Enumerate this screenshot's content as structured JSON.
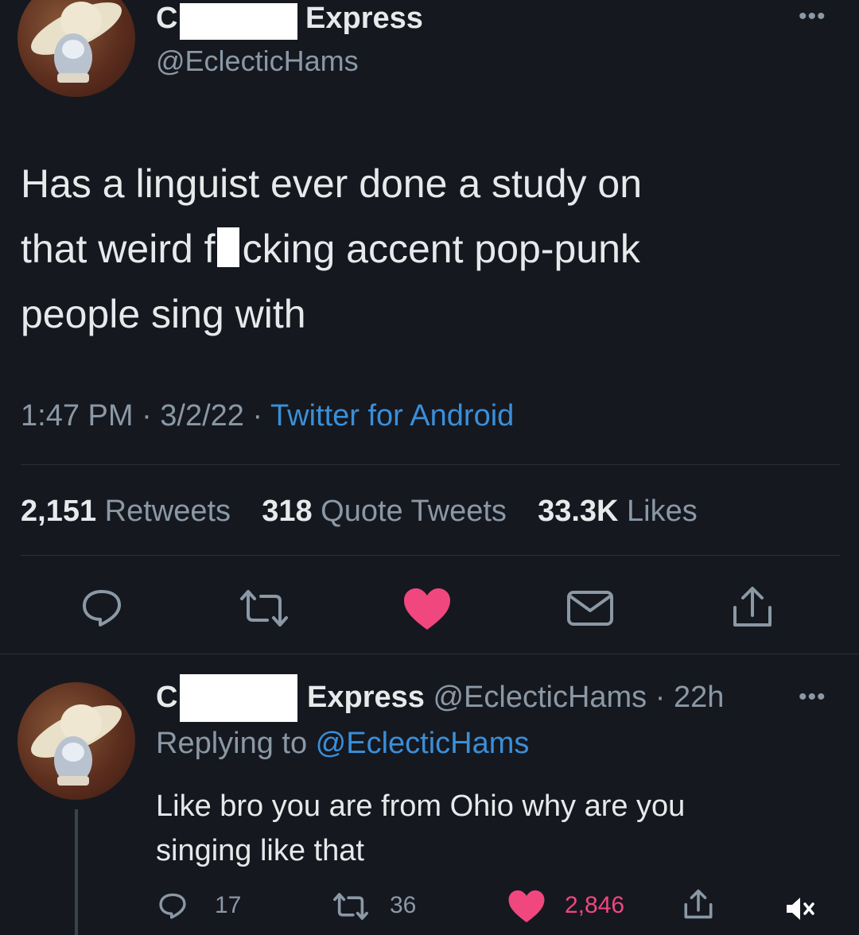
{
  "main_tweet": {
    "name_first": "C",
    "name_last": "Express",
    "handle": "@EclecticHams",
    "more": "•••",
    "text_line1": "Has a linguist ever done a study on",
    "text_line2a": "that weird f",
    "text_line2b": "cking accent pop-punk",
    "text_line3": "people sing with",
    "time": "1:47 PM · 3/2/22 · ",
    "source": "Twitter for Android",
    "stats": {
      "retweets_count": "2,151",
      "retweets_label": "Retweets",
      "quotes_count": "318",
      "quotes_label": "Quote Tweets",
      "likes_count": "33.3K",
      "likes_label": "Likes"
    },
    "actions": [
      "reply-icon",
      "retweet-icon",
      "heart-icon",
      "mail-icon",
      "share-icon"
    ]
  },
  "reply": {
    "name_first": "C",
    "name_last": "Express",
    "handle_time": "@EclecticHams · 22h",
    "more": "•••",
    "replying_label": "Replying to ",
    "replying_handle": "@EclecticHams",
    "text_line1": "Like bro you are from Ohio why are you",
    "text_line2": "singing like that",
    "counts": {
      "replies": "17",
      "retweets": "36",
      "likes": "2,846"
    }
  },
  "colors": {
    "background": "#15181f",
    "like": "#f0477f",
    "link": "#3a8fd9"
  }
}
